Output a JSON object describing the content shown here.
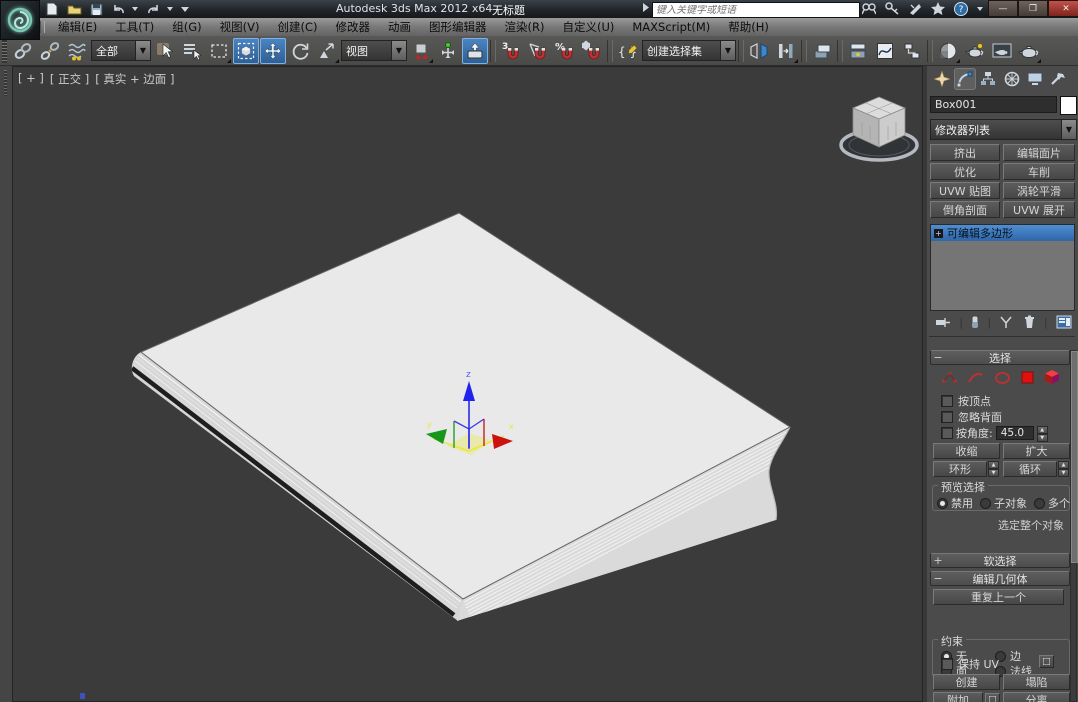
{
  "window": {
    "product_title": "Autodesk 3ds Max  2012 x64",
    "document_title": "无标题",
    "search_placeholder": "键入关键字或短语",
    "minimize": "—",
    "maximize": "❐",
    "close": "✕"
  },
  "menubar": {
    "items": [
      "编辑(E)",
      "工具(T)",
      "组(G)",
      "视图(V)",
      "创建(C)",
      "修改器",
      "动画",
      "图形编辑器",
      "渲染(R)",
      "自定义(U)",
      "MAXScript(M)",
      "帮助(H)"
    ]
  },
  "toolbar": {
    "selection_filter_value": "全部",
    "ref_coord_value": "视图",
    "named_selection_value": "创建选择集",
    "snap_level": "3",
    "percent_glyph": "%",
    "braces_glyph": "{}"
  },
  "viewport": {
    "label_segments": [
      "[ + ]",
      "[ 正交 ]",
      "[ 真实 + 边面 ]"
    ],
    "axis_x": "x",
    "axis_y": "y",
    "axis_z": "z"
  },
  "command_panel": {
    "object_name": "Box001",
    "modifier_list": "修改器列表",
    "modifier_buttons": [
      "挤出",
      "编辑面片",
      "优化",
      "车削",
      "UVW 贴图",
      "涡轮平滑",
      "倒角剖面",
      "UVW 展开"
    ],
    "stack": {
      "item": "可编辑多边形"
    },
    "selection": {
      "title": "选择",
      "by_vertex": "按顶点",
      "ignore_backfacing": "忽略背面",
      "by_angle_label": "按角度:",
      "by_angle_value": "45.0",
      "shrink": "收缩",
      "grow": "扩大",
      "ring": "环形",
      "loop": "循环",
      "preview_label": "预览选择",
      "preview_options": [
        "禁用",
        "子对象",
        "多个"
      ],
      "status": "选定整个对象"
    },
    "soft_selection_title": "软选择",
    "edit_geometry": {
      "title": "编辑几何体",
      "repeat_last": "重复上一个",
      "constraints_label": "约束",
      "constraints": [
        "无",
        "边",
        "面",
        "法线"
      ],
      "preserve_uv": "保持 UV",
      "create": "创建",
      "collapse": "塌陷",
      "attach": "附加",
      "detach": "分离"
    }
  },
  "colors": {
    "highlight_blue": "#3c7cc4",
    "viewport_bg": "#3b3b3b",
    "spine_dark": "#1e1e1e",
    "book_top": "#e9e9e9",
    "axis_x_red": "#cc1111",
    "axis_y_green": "#18961a",
    "axis_z_blue": "#2a2af0"
  }
}
